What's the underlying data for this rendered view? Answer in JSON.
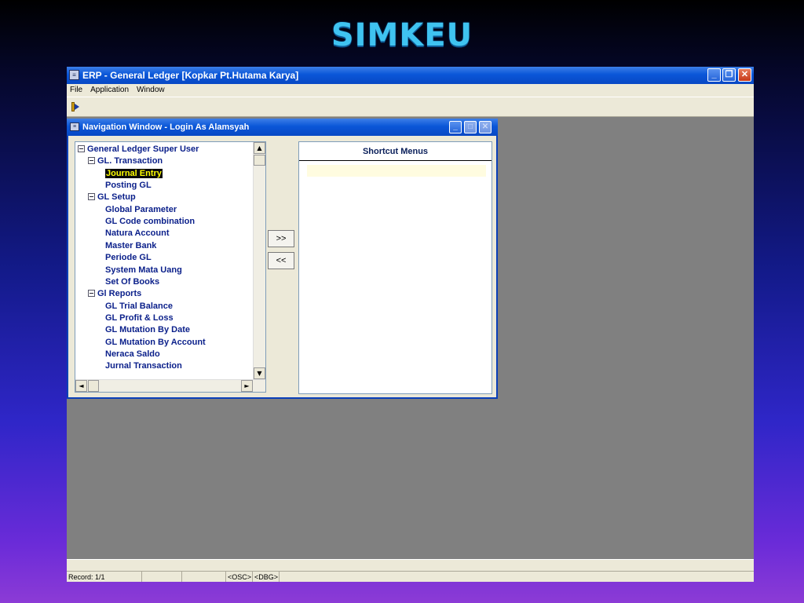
{
  "slide": {
    "title": "SIMKEU"
  },
  "app": {
    "title": "ERP - General Ledger [Kopkar Pt.Hutama Karya]",
    "menu": [
      "File",
      "Application",
      "Window"
    ]
  },
  "nav_window": {
    "title": "Navigation Window - Login As Alamsyah",
    "tree": [
      {
        "label": "General Ledger Super User",
        "level": 0,
        "expandable": true
      },
      {
        "label": "GL. Transaction",
        "level": 1,
        "expandable": true
      },
      {
        "label": "Journal Entry",
        "level": 2,
        "selected": true
      },
      {
        "label": "Posting GL",
        "level": 2
      },
      {
        "label": "GL Setup",
        "level": 1,
        "expandable": true
      },
      {
        "label": "Global Parameter",
        "level": 2
      },
      {
        "label": "GL Code combination",
        "level": 2
      },
      {
        "label": "Natura Account",
        "level": 2
      },
      {
        "label": "Master Bank",
        "level": 2
      },
      {
        "label": "Periode GL",
        "level": 2
      },
      {
        "label": "System Mata Uang",
        "level": 2
      },
      {
        "label": "Set Of Books",
        "level": 2
      },
      {
        "label": "Gl Reports",
        "level": 1,
        "expandable": true
      },
      {
        "label": "GL Trial Balance",
        "level": 2
      },
      {
        "label": "GL Profit & Loss",
        "level": 2
      },
      {
        "label": "GL Mutation By Date",
        "level": 2
      },
      {
        "label": "GL Mutation By Account",
        "level": 2
      },
      {
        "label": "Neraca Saldo",
        "level": 2
      },
      {
        "label": "Jurnal Transaction",
        "level": 2
      }
    ],
    "add_button": ">>",
    "remove_button": "<<",
    "shortcut_header": "Shortcut Menus"
  },
  "status": {
    "record": "Record: 1/1",
    "osc": "<OSC>",
    "dbg": "<DBG>"
  },
  "colors": {
    "titlebar": "#0a56d8",
    "tree_text": "#0a1f8a",
    "selection_bg": "#0a0a0a",
    "selection_text": "#ffff00"
  }
}
